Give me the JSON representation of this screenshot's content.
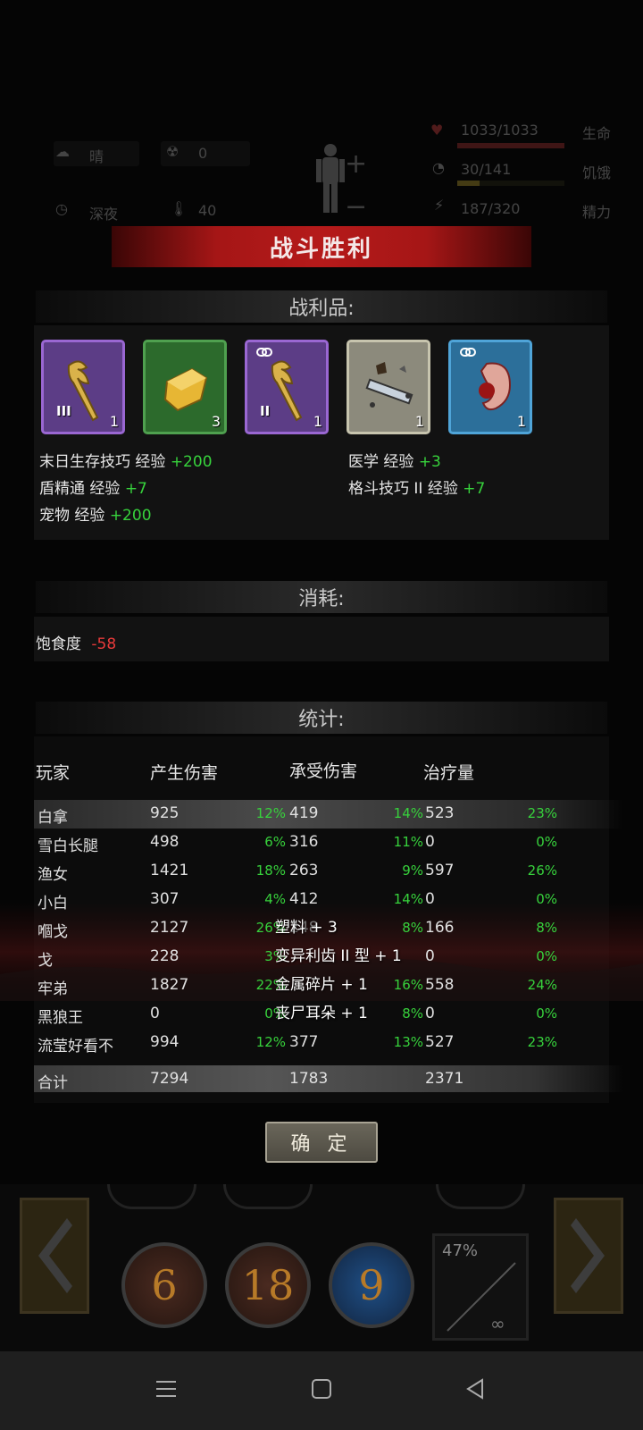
{
  "hud": {
    "weather": "晴",
    "radiation": "0",
    "time_of_day": "深夜",
    "temperature": "40",
    "health": {
      "value": "1033/1033",
      "label": "生命",
      "fraction": 1.0
    },
    "hunger": {
      "value": "30/141",
      "label": "饥饿",
      "fraction": 0.21
    },
    "energy": {
      "value": "187/320",
      "label": "精力",
      "fraction": 0.58
    }
  },
  "banner_title": "战斗胜利",
  "loot": {
    "heading": "战利品:",
    "items": [
      {
        "icon": "claw-weapon-icon",
        "tier": "III",
        "count": "1",
        "rarity": "purple",
        "linked": false
      },
      {
        "icon": "gold-block-icon",
        "tier": "",
        "count": "3",
        "rarity": "green",
        "linked": false
      },
      {
        "icon": "claw-weapon-icon",
        "tier": "II",
        "count": "1",
        "rarity": "purple",
        "linked": true
      },
      {
        "icon": "metal-scrap-icon",
        "tier": "",
        "count": "1",
        "rarity": "grey",
        "linked": false
      },
      {
        "icon": "zombie-ear-icon",
        "tier": "",
        "count": "1",
        "rarity": "blue",
        "linked": true
      }
    ],
    "xp": [
      {
        "skill": "末日生存技巧 经验",
        "gain": "+200"
      },
      {
        "skill": "医学 经验",
        "gain": "+3"
      },
      {
        "skill": "盾精通 经验",
        "gain": "+7"
      },
      {
        "skill": "格斗技巧 II 经验",
        "gain": "+7"
      },
      {
        "skill": "宠物 经验",
        "gain": "+200"
      }
    ]
  },
  "consumption": {
    "heading": "消耗:",
    "items": [
      {
        "name": "饱食度",
        "delta": "-58"
      }
    ]
  },
  "stats": {
    "heading": "统计:",
    "columns": [
      "玩家",
      "产生伤害",
      "承受伤害",
      "治疗量"
    ],
    "rows": [
      {
        "player": "白拿",
        "dealt": "925",
        "dealt_pct": "12%",
        "taken": "419",
        "taken_pct": "14%",
        "heal": "523",
        "heal_pct": "23%"
      },
      {
        "player": "雪白长腿",
        "dealt": "498",
        "dealt_pct": "6%",
        "taken": "316",
        "taken_pct": "11%",
        "heal": "0",
        "heal_pct": "0%"
      },
      {
        "player": "渔女",
        "dealt": "1421",
        "dealt_pct": "18%",
        "taken": "263",
        "taken_pct": "9%",
        "heal": "597",
        "heal_pct": "26%"
      },
      {
        "player": "小白",
        "dealt": "307",
        "dealt_pct": "4%",
        "taken": "412",
        "taken_pct": "14%",
        "heal": "0",
        "heal_pct": "0%"
      },
      {
        "player": "嗰戈",
        "dealt": "2127",
        "dealt_pct": "26%",
        "taken": "248",
        "taken_pct": "8%",
        "heal": "166",
        "heal_pct": "8%"
      },
      {
        "player": "戈",
        "dealt": "228",
        "dealt_pct": "3%",
        "taken": "",
        "taken_pct": "",
        "heal": "0",
        "heal_pct": "0%"
      },
      {
        "player": "牢弟",
        "dealt": "1827",
        "dealt_pct": "22%",
        "taken": "",
        "taken_pct": "16%",
        "heal": "558",
        "heal_pct": "24%"
      },
      {
        "player": "黑狼王",
        "dealt": "0",
        "dealt_pct": "0%",
        "taken": "",
        "taken_pct": "8%",
        "heal": "0",
        "heal_pct": "0%"
      },
      {
        "player": "流莹好看不",
        "dealt": "994",
        "dealt_pct": "12%",
        "taken": "377",
        "taken_pct": "13%",
        "heal": "527",
        "heal_pct": "23%"
      }
    ],
    "total": {
      "label": "合计",
      "dealt": "7294",
      "taken": "1783",
      "heal": "2371"
    }
  },
  "pickup_toasts": [
    "塑料 + 3",
    "变异利齿 II 型 + 1",
    "金属碎片 + 1",
    "丧尸耳朵 + 1"
  ],
  "confirm_label": "确 定",
  "skills": [
    "6",
    "18",
    "9"
  ],
  "ammo": {
    "percent": "47%",
    "reserve": "∞"
  }
}
